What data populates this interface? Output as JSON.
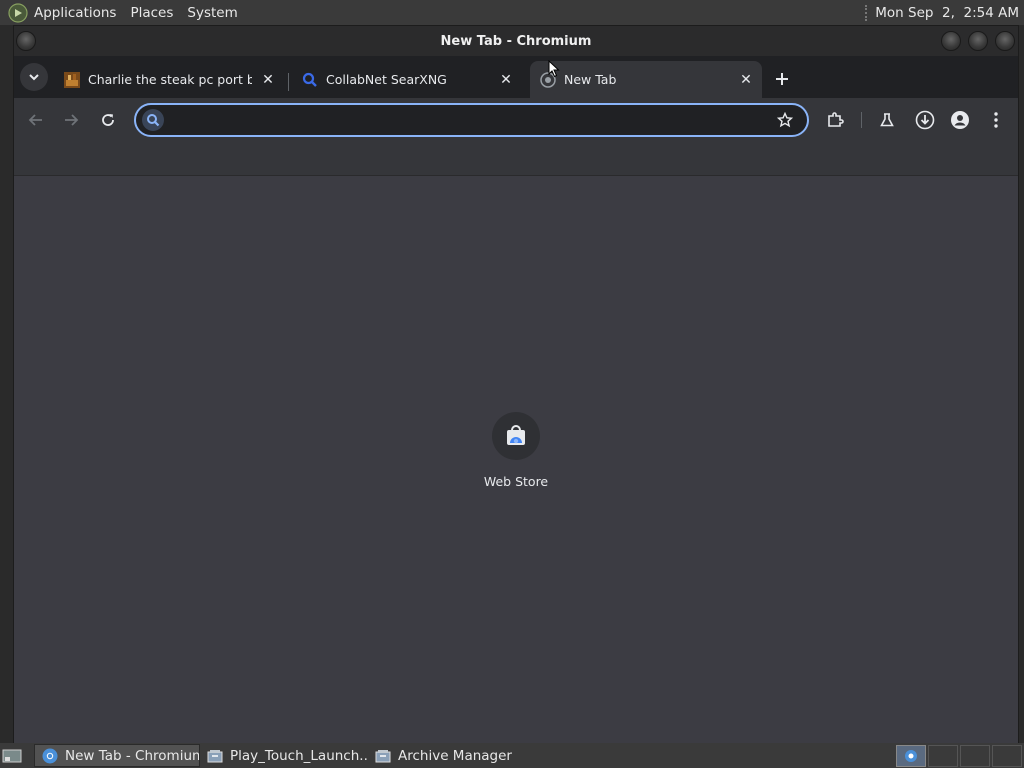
{
  "top_panel": {
    "menus": [
      "Applications",
      "Places",
      "System"
    ],
    "clock": "Mon Sep  2,  2:54 AM"
  },
  "window": {
    "title": "New Tab - Chromium"
  },
  "tabs": [
    {
      "title": "Charlie the steak pc port by L",
      "favicon": "game-thumbnail-icon",
      "active": false
    },
    {
      "title": "CollabNet SearXNG",
      "favicon": "search-icon",
      "active": false
    },
    {
      "title": "New Tab",
      "favicon": "chromium-icon",
      "active": true
    }
  ],
  "omnibox": {
    "value": "",
    "placeholder": ""
  },
  "shortcuts": [
    {
      "label": "Web Store",
      "icon": "web-store-icon"
    }
  ],
  "taskbar": [
    {
      "label": "New Tab - Chromium",
      "icon": "chromium-icon",
      "active": true
    },
    {
      "label": "Play_Touch_Launch...",
      "icon": "archive-icon",
      "active": false
    },
    {
      "label": "Archive Manager",
      "icon": "archive-icon",
      "active": false
    }
  ],
  "colors": {
    "accent": "#8ab4f8",
    "tabstrip_bg": "#202124",
    "toolbar_bg": "#35363a",
    "content_bg": "#3c3c43"
  }
}
